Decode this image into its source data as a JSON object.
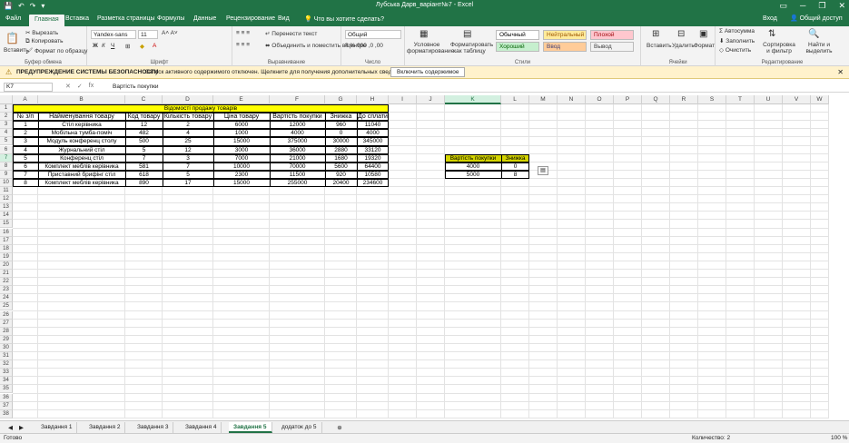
{
  "window": {
    "title": "Лубська Дарв_варіант№7 - Excel",
    "min_icon": "minimize-icon",
    "max_icon": "restore-icon",
    "close_icon": "close-icon"
  },
  "tabs": [
    "Файл",
    "Главная",
    "Вставка",
    "Разметка страницы",
    "Формулы",
    "Данные",
    "Рецензирование",
    "Вид"
  ],
  "tell_me": "Что вы хотите сделать?",
  "login": "Вход",
  "share": "Общий доступ",
  "ribbon": {
    "paste": "Вставить",
    "cut": "Вырезать",
    "copy": "Копировать",
    "format_painter": "Формат по образцу",
    "clipboard": "Буфер обмена",
    "font_name": "Yandex-sans",
    "font_size": "11",
    "font_group": "Шрифт",
    "wrap_text": "Перенести текст",
    "merge_center": "Объединить и поместить в центре",
    "align_group": "Выравнивание",
    "number_format": "Общий",
    "number_group": "Число",
    "conditional": "Условное форматирование",
    "format_table": "Форматировать как таблицу",
    "styles_group": "Стили",
    "styles": [
      {
        "label": "Обычный",
        "bg": "#ffffff",
        "fg": "#000000"
      },
      {
        "label": "Нейтральный",
        "bg": "#ffeb9c",
        "fg": "#9c5700"
      },
      {
        "label": "Плохой",
        "bg": "#ffc7ce",
        "fg": "#9c0006"
      },
      {
        "label": "Хороший",
        "bg": "#c6efce",
        "fg": "#006100"
      },
      {
        "label": "Ввод",
        "bg": "#ffcc99",
        "fg": "#3f3f76"
      },
      {
        "label": "Вывод",
        "bg": "#f2f2f2",
        "fg": "#3f3f3f"
      }
    ],
    "insert": "Вставить",
    "delete": "Удалить",
    "format": "Формат",
    "cells_group": "Ячейки",
    "autosum": "Автосумма",
    "fill": "Заполнить",
    "clear": "Очистить",
    "sort_filter": "Сортировка и фильтр",
    "find_select": "Найти и выделить",
    "edit_group": "Редактирование"
  },
  "warning": {
    "title": "ПРЕДУПРЕЖДЕНИЕ СИСТЕМЫ БЕЗОПАСНОСТИ",
    "message": "Запуск активного содержимого отключен. Щелкните для получения дополнительных сведений.",
    "button": "Включить содержимое"
  },
  "formula_bar": {
    "name_box": "K7",
    "value": "Вартість покупки"
  },
  "columns": [
    {
      "letter": "A",
      "w": 28
    },
    {
      "letter": "B",
      "w": 96
    },
    {
      "letter": "C",
      "w": 41
    },
    {
      "letter": "D",
      "w": 56
    },
    {
      "letter": "E",
      "w": 62
    },
    {
      "letter": "F",
      "w": 61
    },
    {
      "letter": "G",
      "w": 35
    },
    {
      "letter": "H",
      "w": 35
    },
    {
      "letter": "I",
      "w": 31
    },
    {
      "letter": "J",
      "w": 31
    },
    {
      "letter": "K",
      "w": 62
    },
    {
      "letter": "L",
      "w": 31
    },
    {
      "letter": "M",
      "w": 31
    },
    {
      "letter": "N",
      "w": 31
    },
    {
      "letter": "O",
      "w": 31
    },
    {
      "letter": "P",
      "w": 31
    },
    {
      "letter": "Q",
      "w": 31
    },
    {
      "letter": "R",
      "w": 31
    },
    {
      "letter": "S",
      "w": 31
    },
    {
      "letter": "T",
      "w": 31
    },
    {
      "letter": "U",
      "w": 31
    },
    {
      "letter": "V",
      "w": 31
    },
    {
      "letter": "W",
      "w": 20
    }
  ],
  "selected_col": "K",
  "selected_row": 7,
  "rows_count": 38,
  "table": {
    "title": "Відомості продажу товарів",
    "headers": [
      "№ з/п",
      "Найменування товару",
      "Код товару",
      "Кількість товару",
      "Ціна товару",
      "Вартість покупки",
      "Знижка",
      "До сплати"
    ],
    "rows": [
      [
        "1",
        "Стіл керівника",
        "12",
        "2",
        "6000",
        "12000",
        "960",
        "11040"
      ],
      [
        "2",
        "Мобільна тумба-поміч",
        "482",
        "4",
        "1000",
        "4000",
        "0",
        "4000"
      ],
      [
        "3",
        "Модуль конференц столу",
        "500",
        "25",
        "15000",
        "375000",
        "30000",
        "345000"
      ],
      [
        "4",
        "Журнальний стіл",
        "5",
        "12",
        "3000",
        "36000",
        "2880",
        "33120"
      ],
      [
        "5",
        "Конференц стіл",
        "7",
        "3",
        "7000",
        "21000",
        "1680",
        "19320"
      ],
      [
        "6",
        "Комплект меблів керівника",
        "581",
        "7",
        "10000",
        "70000",
        "5600",
        "64400"
      ],
      [
        "7",
        "Приставний брифінг стіл",
        "618",
        "5",
        "2300",
        "11500",
        "920",
        "10580"
      ],
      [
        "8",
        "Комплект меблів керівника",
        "890",
        "17",
        "15000",
        "255000",
        "20400",
        "234600"
      ]
    ]
  },
  "side_table": {
    "headers": [
      "Вартість покупки",
      "Знижка"
    ],
    "rows": [
      [
        "4000",
        "0"
      ],
      [
        "5000",
        "8"
      ]
    ]
  },
  "sheets": [
    "Завдання 1",
    "Завдання 2",
    "Завдання 3",
    "Завдання 4",
    "Завдання 5",
    "додаток до 5"
  ],
  "active_sheet": 4,
  "status": {
    "ready": "Готово",
    "count": "Количество: 2",
    "zoom": "100 %"
  },
  "colors": {
    "accent": "#217346",
    "title_fill": "#ffff00",
    "side_header_fill": "#d4d400"
  }
}
